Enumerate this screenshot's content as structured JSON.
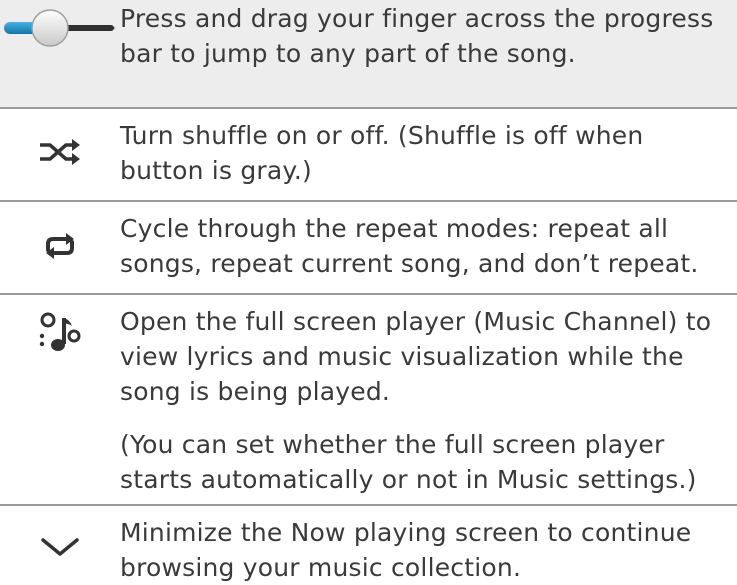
{
  "rows": [
    {
      "icon": "progress-slider-icon",
      "text": "Press and drag your finger across the progress bar to jump to any part of the song."
    },
    {
      "icon": "shuffle-icon",
      "text": "Turn shuffle on or off. (Shuffle is off when button is gray.)"
    },
    {
      "icon": "repeat-icon",
      "text": "Cycle through the repeat modes: repeat all songs, repeat current song, and don’t repeat."
    },
    {
      "icon": "music-channel-icon",
      "text": "Open the full screen player (Music Channel) to view lyrics and music visualization while the song is being played.",
      "note": "(You can set whether the full screen player starts automatically or not in Music settings.)"
    },
    {
      "icon": "chevron-down-icon",
      "text": "Minimize the Now playing screen to continue browsing your music collection."
    }
  ],
  "colors": {
    "accent_blue": "#1e90c8",
    "icon_gray": "#333333",
    "divider": "#9a9a9a",
    "first_row_bg": "#ededed"
  }
}
